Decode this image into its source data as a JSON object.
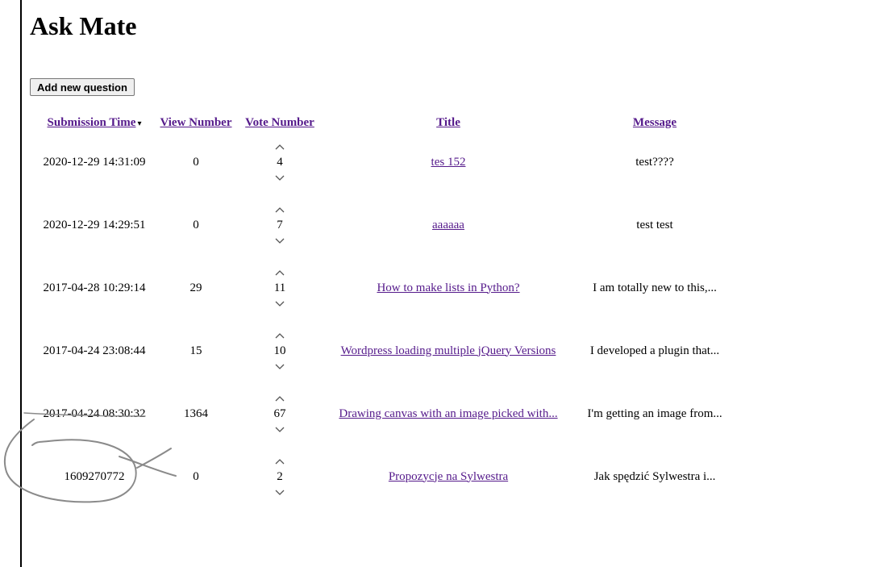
{
  "title": "Ask Mate",
  "add_button_label": "Add new question",
  "headers": {
    "submission_time": "Submission Time",
    "sort_indicator": "▾",
    "view_number": "View Number",
    "vote_number": "Vote Number",
    "title": "Title",
    "message": "Message"
  },
  "icons": {
    "upvote": "chevron-up-icon",
    "downvote": "chevron-down-icon"
  },
  "questions": [
    {
      "time": "2020-12-29 14:31:09",
      "views": "0",
      "votes": "4",
      "title": "tes 152",
      "message": "test????"
    },
    {
      "time": "2020-12-29 14:29:51",
      "views": "0",
      "votes": "7",
      "title": "aaaaaa",
      "message": "test test"
    },
    {
      "time": "2017-04-28 10:29:14",
      "views": "29",
      "votes": "11",
      "title": "How to make lists in Python?",
      "message": "I am totally new to this,..."
    },
    {
      "time": "2017-04-24 23:08:44",
      "views": "15",
      "votes": "10",
      "title": "Wordpress loading multiple jQuery Versions",
      "message": "I developed a plugin that..."
    },
    {
      "time": "2017-04-24 08:30:32",
      "views": "1364",
      "votes": "67",
      "title": "Drawing canvas with an image picked with...",
      "message": "I'm getting an image from..."
    },
    {
      "time": "1609270772",
      "views": "0",
      "votes": "2",
      "title": "Propozycje na Sylwestra",
      "message": "Jak spędzić Sylwestra i..."
    }
  ],
  "colors": {
    "link": "#551a8b",
    "scribble": "#8a8a8a"
  }
}
